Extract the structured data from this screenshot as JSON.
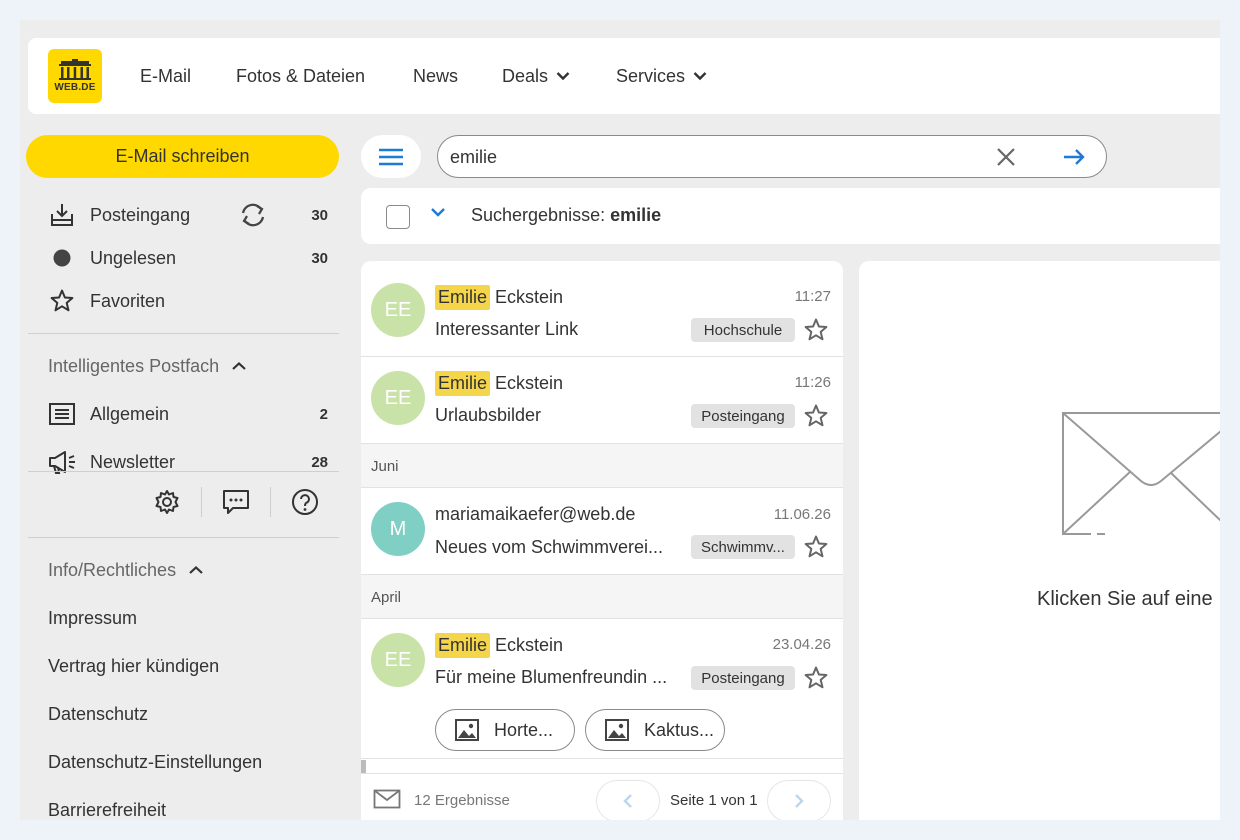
{
  "nav": {
    "logo_text": "WEB.DE",
    "items": [
      "E-Mail",
      "Fotos & Dateien",
      "News",
      "Deals",
      "Services"
    ]
  },
  "sidebar": {
    "compose_label": "E-Mail schreiben",
    "folders": [
      {
        "label": "Posteingang",
        "count": "30",
        "icon": "inbox-icon"
      },
      {
        "label": "Ungelesen",
        "count": "30",
        "icon": "unread-dot-icon"
      },
      {
        "label": "Favoriten",
        "count": "",
        "icon": "star-icon"
      }
    ],
    "smart_heading": "Intelligentes Postfach",
    "smart_items": [
      {
        "label": "Allgemein",
        "count": "2",
        "icon": "list-icon"
      },
      {
        "label": "Newsletter",
        "count": "28",
        "icon": "megaphone-icon"
      }
    ],
    "info_heading": "Info/Rechtliches",
    "info_links": [
      "Impressum",
      "Vertrag hier kündigen",
      "Datenschutz",
      "Datenschutz-Einstellungen",
      "Barrierefreiheit"
    ]
  },
  "search": {
    "value": "emilie"
  },
  "results": {
    "label": "Suchergebnisse: ",
    "query": "emilie"
  },
  "mails": [
    {
      "initials": "EE",
      "highlight": "Emilie",
      "sender": "Eckstein",
      "time": "11:27",
      "subject": "Interessanter Link",
      "tag": "Hochschule",
      "avatar_color": "#c9e2a8"
    },
    {
      "initials": "EE",
      "highlight": "Emilie",
      "sender": "Eckstein",
      "time": "11:26",
      "subject": "Urlaubsbilder",
      "tag": "Posteingang",
      "avatar_color": "#c9e2a8"
    },
    {
      "initials": "M",
      "highlight": "",
      "sender": "mariamaikaefer@web.de",
      "time": "11.06.26",
      "subject": "Neues vom Schwimmverei...",
      "tag": "Schwimmv...",
      "avatar_color": "#7fcfc4"
    },
    {
      "initials": "EE",
      "highlight": "Emilie",
      "sender": "Eckstein",
      "time": "23.04.26",
      "subject": "Für meine Blumenfreundin ...",
      "tag": "Posteingang",
      "avatar_color": "#c9e2a8"
    }
  ],
  "groups": [
    "Juni",
    "April"
  ],
  "attachments": [
    "Horte...",
    "Kaktus..."
  ],
  "footer": {
    "count": "12 Ergebnisse",
    "page": "Seite 1 von 1"
  },
  "preview": {
    "hint": "Klicken Sie auf eine"
  },
  "colors": {
    "brand_yellow": "#ffd800",
    "accent_blue": "#1c7bd4",
    "highlight": "#f5d64a"
  }
}
